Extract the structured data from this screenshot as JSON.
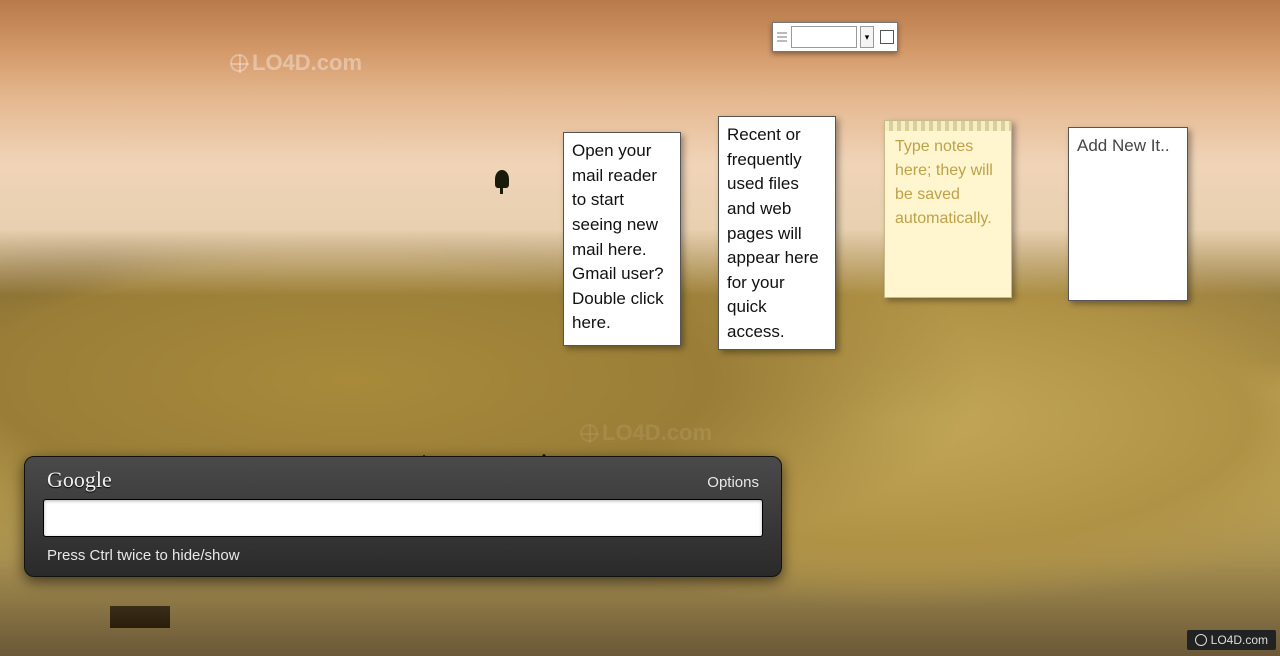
{
  "watermark": {
    "text": "LO4D.com",
    "badge": "LO4D.com"
  },
  "mini_toolbar": {
    "dropdown_glyph": "▾"
  },
  "gadgets": {
    "mail": {
      "text": "Open your mail reader to start seeing new mail here. Gmail user? Double click here."
    },
    "recent": {
      "text": "Recent or frequently used files and web pages will appear here for your quick access."
    },
    "note": {
      "placeholder": "Type notes here; they will be saved automatically."
    },
    "add": {
      "placeholder": "Add New It.."
    }
  },
  "google": {
    "title": "Google",
    "options": "Options",
    "input_value": "",
    "hint": "Press Ctrl twice to hide/show"
  }
}
